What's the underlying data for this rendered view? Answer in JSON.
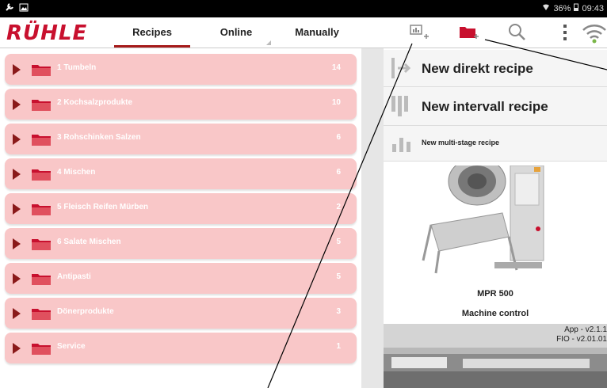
{
  "status_bar": {
    "left_icons": [
      "wrench-icon",
      "image-icon"
    ],
    "battery": "36%",
    "time": "09:43"
  },
  "app_bar": {
    "logo": "RÜHLE",
    "tabs": [
      {
        "label": "Recipes",
        "active": true
      },
      {
        "label": "Online",
        "active": false
      },
      {
        "label": "Manually",
        "active": false
      }
    ],
    "toolbar_icons": [
      "add-recipe-icon",
      "add-folder-icon",
      "search-icon",
      "more-vert-icon",
      "wifi-icon"
    ]
  },
  "folders": [
    {
      "label": "1 Tumbeln",
      "count": "14"
    },
    {
      "label": "2 Kochsalzprodukte",
      "count": "10"
    },
    {
      "label": "3 Rohschinken Salzen",
      "count": "6"
    },
    {
      "label": "4 Mischen",
      "count": "6"
    },
    {
      "label": "5 Fleisch Reifen Mürben",
      "count": "2"
    },
    {
      "label": "6 Salate Mischen",
      "count": "5"
    },
    {
      "label": "Antipasti",
      "count": "5"
    },
    {
      "label": "Dönerprodukte",
      "count": "3"
    },
    {
      "label": "Service",
      "count": "1"
    }
  ],
  "right_panel": {
    "new_direct": "New direkt recipe",
    "new_interval": "New intervall recipe",
    "new_multistage": "New multi-stage recipe",
    "machine_model": "MPR 500",
    "machine_caption": "Machine control",
    "version_app": "App - v2.1.1",
    "version_fio": "FIO - v2.01.01"
  },
  "colors": {
    "brand_red": "#c8102e",
    "row_pink": "#f9c7c8",
    "arrow_dark": "#8a1a1a"
  }
}
